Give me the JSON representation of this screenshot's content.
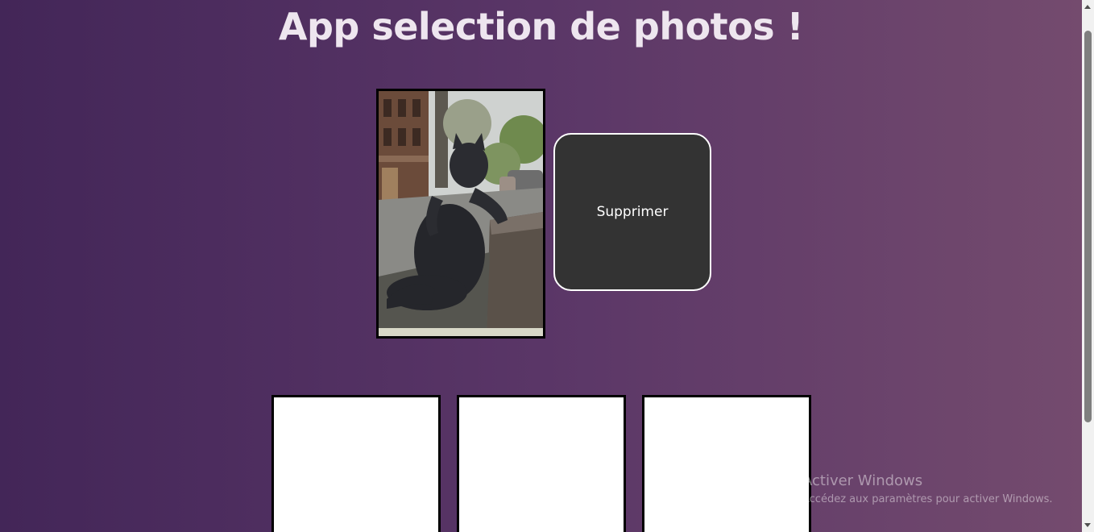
{
  "page": {
    "title": "App selection de photos !"
  },
  "main_photo": {
    "subject": "cat statue photo",
    "border_color": "#000000"
  },
  "actions": {
    "delete_label": "Supprimer"
  },
  "thumbnails": [
    {
      "state": "empty"
    },
    {
      "state": "empty"
    },
    {
      "state": "empty"
    }
  ],
  "os_watermark": {
    "title": "Activer Windows",
    "subtitle": "Accédez aux paramètres pour activer Windows."
  },
  "colors": {
    "gradient_start": "#432658",
    "gradient_end": "#744b6e",
    "button_bg": "#333333",
    "title_text": "#eee6ef"
  }
}
